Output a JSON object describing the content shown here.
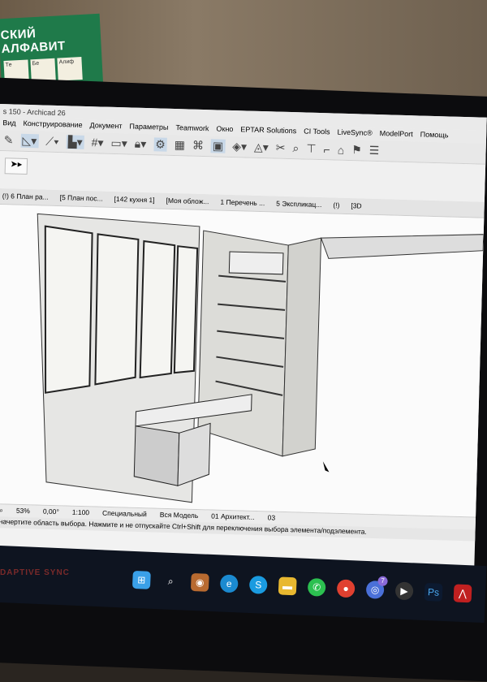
{
  "poster": {
    "text": "СКИЙ АЛФАВИТ",
    "cards": [
      "Те",
      "Бе",
      "Алиф"
    ]
  },
  "window": {
    "title": "s 150 - Archicad 26"
  },
  "menu": [
    "Вид",
    "Конструирование",
    "Документ",
    "Параметры",
    "Teamwork",
    "Окно",
    "EPTAR Solutions",
    "CI Tools",
    "LiveSync®",
    "ModelPort",
    "Помощь"
  ],
  "tabs": [
    "(!) 6 План ра...",
    "[5 План пос...",
    "[142 кухня 1]",
    "[Моя облож...",
    "1 Перечень ...",
    "5 Экспликац...",
    "(!)",
    "[3D"
  ],
  "status": {
    "zoom": "53%",
    "angle": "0,00°",
    "scale": "1:100",
    "layer": "Специальный",
    "model": "Вся Модель",
    "pen": "01 Архитект...",
    "last": "03"
  },
  "hint": "и начертите область выбора. Нажмите и не отпускайте Ctrl+Shift для переключения выбора элемента/подэлемента.",
  "taskbar": {
    "badge": "7",
    "ps": "Ps"
  },
  "watermark": "DAPTIVE SYNC"
}
